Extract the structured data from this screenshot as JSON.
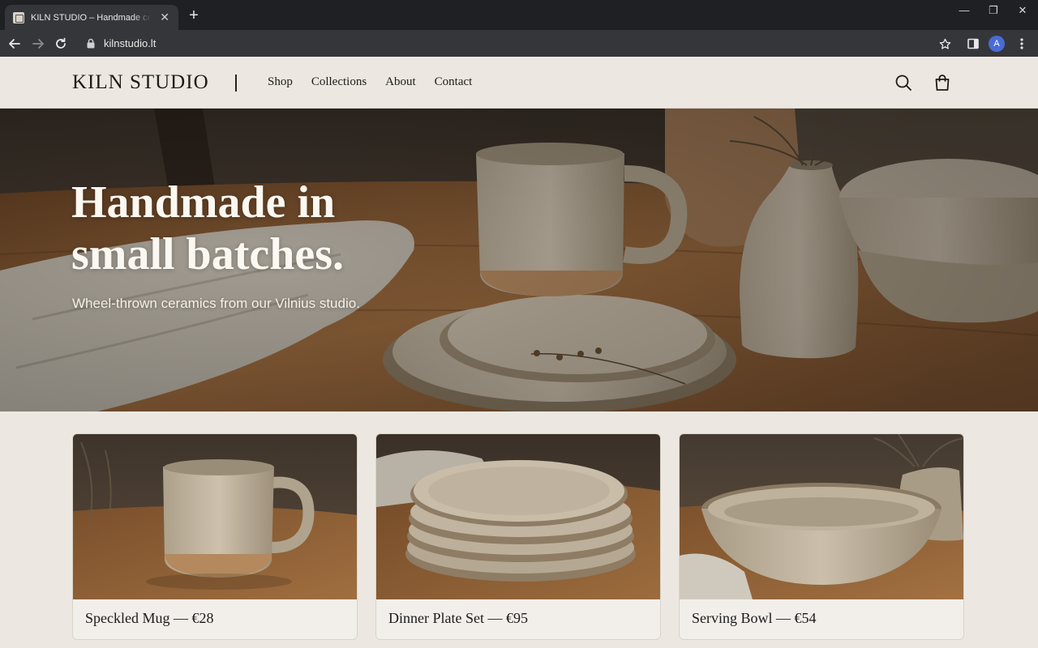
{
  "browser": {
    "tab_title": "KILN STUDIO – Handmade ceramics",
    "url": "kilnstudio.lt",
    "avatar_letter": "A"
  },
  "site": {
    "logo": "KILN STUDIO",
    "nav": [
      "Shop",
      "Collections",
      "About",
      "Contact"
    ]
  },
  "hero": {
    "title": "Handmade in small batches.",
    "subtitle": "Wheel-thrown ceramics from our Vilnius studio."
  },
  "products": [
    {
      "name": "Speckled Mug",
      "price": "€28",
      "label": "Speckled Mug — €28"
    },
    {
      "name": "Dinner Plate Set",
      "price": "€95",
      "label": "Dinner Plate Set — €95"
    },
    {
      "name": "Serving Bowl",
      "price": "€54",
      "label": "Serving Bowl — €54"
    }
  ],
  "icons": {
    "search": "search-icon",
    "cart": "shopping-bag-icon"
  },
  "colors": {
    "page_bg": "#ece8e1",
    "text": "#1c1b19",
    "chrome_dark": "#1f2023",
    "chrome_toolbar": "#35363a"
  }
}
